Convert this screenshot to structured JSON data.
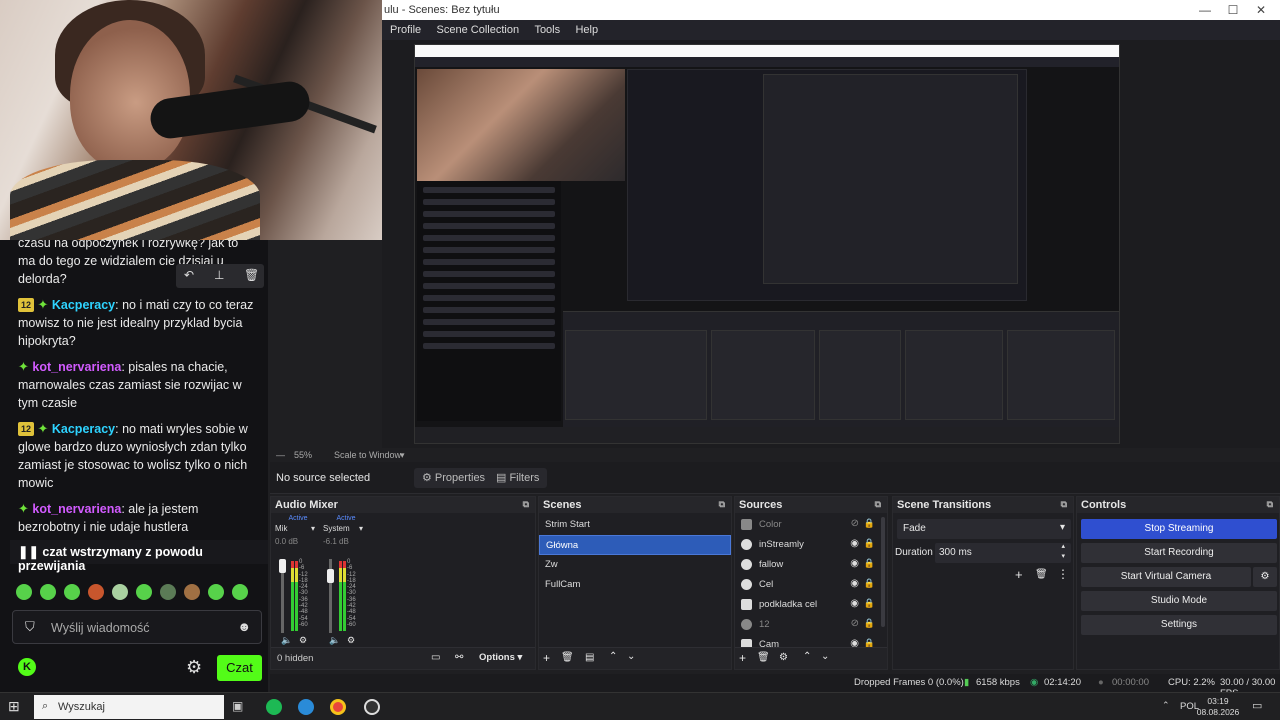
{
  "window": {
    "title": "ulu - Scenes: Bez tytułu",
    "minimize": "—",
    "maximize": "☐",
    "close": "✕"
  },
  "menu": {
    "items": [
      "Profile",
      "Scene Collection",
      "Tools",
      "Help"
    ]
  },
  "preview": {
    "zoom_percent": "55%",
    "scale_label": "Scale to Window"
  },
  "source_bar": {
    "no_source": "No source selected",
    "properties": "Properties",
    "filters": "Filters"
  },
  "audio_mixer": {
    "title": "Audio Mixer",
    "channels": [
      {
        "name": "Mik",
        "active": "Active",
        "db": "0.0 dB"
      },
      {
        "name": "System",
        "active": "Active",
        "db": "-6.1 dB"
      }
    ],
    "scale": [
      "0",
      "-6",
      "-12",
      "-18",
      "-24",
      "-30",
      "-36",
      "-42",
      "-48",
      "-54",
      "-60"
    ],
    "hidden": "0 hidden",
    "options": "Options"
  },
  "scenes": {
    "title": "Scenes",
    "items": [
      "Strim Start",
      "Główna",
      "Zw",
      "FullCam"
    ],
    "selected_index": 1
  },
  "sources": {
    "title": "Sources",
    "items": [
      {
        "name": "Color",
        "icon": "brush-icon",
        "hidden": true
      },
      {
        "name": "inStreamly",
        "icon": "globe-icon",
        "hidden": false
      },
      {
        "name": "fallow",
        "icon": "globe-icon",
        "hidden": false
      },
      {
        "name": "Cel",
        "icon": "globe-icon",
        "hidden": false
      },
      {
        "name": "podkladka cel",
        "icon": "brush-icon",
        "hidden": false
      },
      {
        "name": "12",
        "icon": "globe-icon",
        "hidden": true
      },
      {
        "name": "Cam",
        "icon": "camera-icon",
        "hidden": false
      }
    ]
  },
  "transitions": {
    "title": "Scene Transitions",
    "selected": "Fade",
    "duration_label": "Duration",
    "duration_value": "300 ms"
  },
  "controls": {
    "title": "Controls",
    "stop_streaming": "Stop Streaming",
    "start_recording": "Start Recording",
    "start_virtual_camera": "Start Virtual Camera",
    "studio_mode": "Studio Mode",
    "settings": "Settings"
  },
  "status": {
    "dropped_frames": "Dropped Frames 0 (0.0%)",
    "bitrate": "6158 kbps",
    "stream_time": "02:14:20",
    "rec_time": "00:00:00",
    "cpu": "CPU: 2.2%",
    "fps": "30.00 / 30.00 FPS"
  },
  "chat": {
    "partial_top": "czasu na odpoczynek i rozrywkę? jak to ma do tego ze widzialem cie dzisiaj u delorda?",
    "messages": [
      {
        "badge": "12",
        "user": "Kacperacy",
        "user_color": "#2ed3ff",
        "text": "no i mati czy to co teraz mowisz to nie jest idealny przyklad bycia hipokryta?"
      },
      {
        "badge": "",
        "user": "kot_nervariena",
        "user_color": "#d25bff",
        "text": "pisales na chacie, marnowales czas zamiast sie rozwijac w tym czasie"
      },
      {
        "badge": "12",
        "user": "Kacperacy",
        "user_color": "#2ed3ff",
        "text": "no mati wryles sobie w glowe bardzo duzo wyniosłych zdan tylko zamiast je stosowac to wolisz tylko o nich mowic"
      },
      {
        "badge": "",
        "user": "kot_nervariena",
        "user_color": "#d25bff",
        "text": "ale ja jestem bezrobotny i nie udaje hustlera"
      }
    ],
    "paused_banner": "czat wstrzymany z powodu przewijania",
    "input_placeholder": "Wyślij wiadomość",
    "send_button": "Czat"
  },
  "taskbar": {
    "search_placeholder": "Wyszukaj",
    "language": "POL",
    "time": "03:19",
    "date": "08.08.2026"
  },
  "colors": {
    "accent": "#2f4fd0",
    "kick_green": "#53fc18",
    "selected_scene": "#2d5cb8"
  }
}
